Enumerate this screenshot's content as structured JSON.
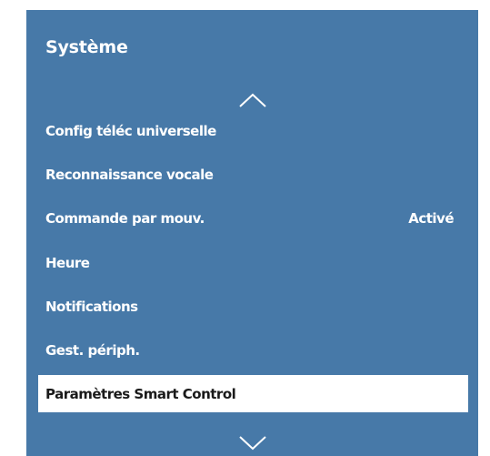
{
  "panel": {
    "title": "Système",
    "scroll_up_icon": "chevron-up-icon",
    "scroll_down_icon": "chevron-down-icon"
  },
  "menu": {
    "items": [
      {
        "label": "Config téléc universelle",
        "value": ""
      },
      {
        "label": "Reconnaissance vocale",
        "value": ""
      },
      {
        "label": "Commande par mouv.",
        "value": "Activé"
      },
      {
        "label": "Heure",
        "value": ""
      },
      {
        "label": "Notifications",
        "value": ""
      },
      {
        "label": "Gest. périph.",
        "value": ""
      },
      {
        "label": "Paramètres Smart Control",
        "value": ""
      }
    ],
    "selected_index": 6
  },
  "colors": {
    "panel_background": "#4779a8",
    "text": "#ffffff",
    "selected_background": "#ffffff",
    "selected_text": "#1a1a1a"
  }
}
